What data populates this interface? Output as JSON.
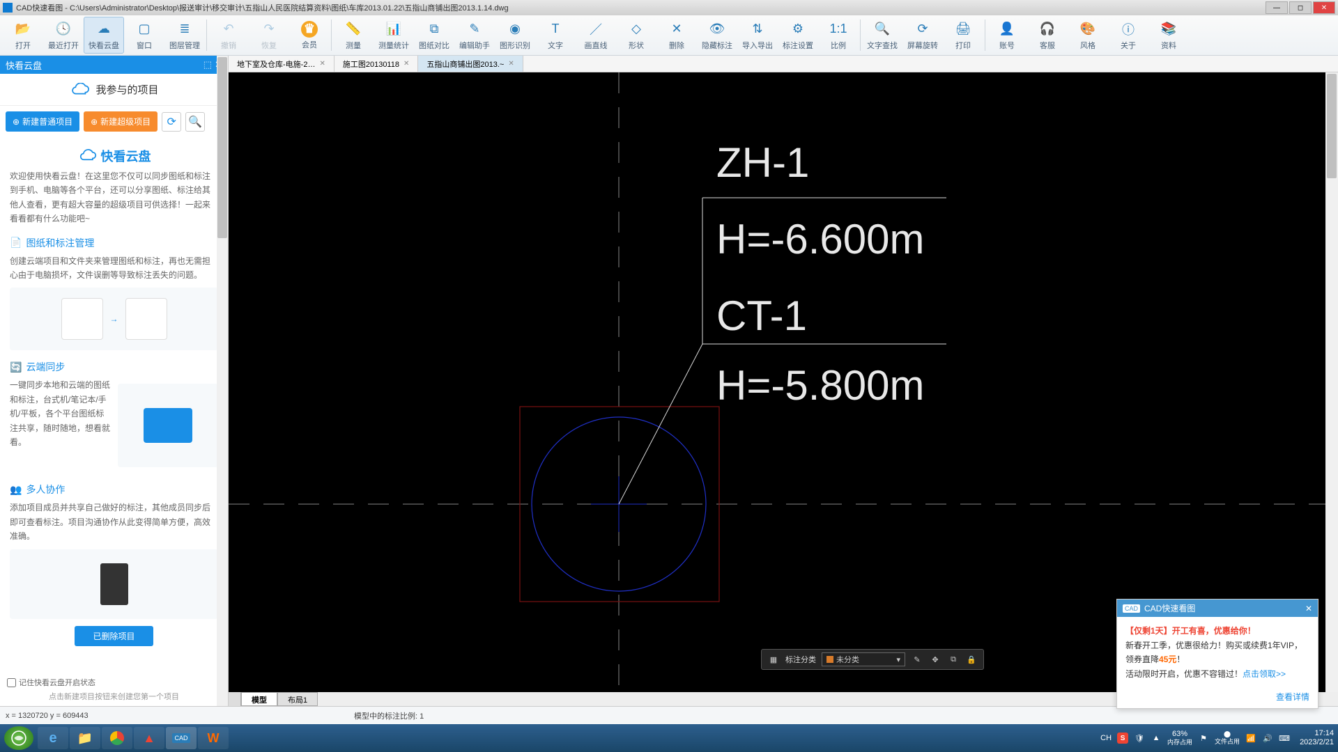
{
  "title": "CAD快速看图 - C:\\Users\\Administrator\\Desktop\\报送审计\\移交审计\\五指山人民医院结算资料\\图纸\\车库2013.01.22\\五指山商铺出图2013.1.14.dwg",
  "toolbar": [
    {
      "label": "打开"
    },
    {
      "label": "最近打开"
    },
    {
      "label": "快看云盘"
    },
    {
      "label": "窗口"
    },
    {
      "label": "图层管理"
    },
    {
      "label": "撤销"
    },
    {
      "label": "恢复"
    },
    {
      "label": "会员"
    },
    {
      "label": "测量"
    },
    {
      "label": "测量统计"
    },
    {
      "label": "图纸对比"
    },
    {
      "label": "编辑助手"
    },
    {
      "label": "图形识别"
    },
    {
      "label": "文字"
    },
    {
      "label": "画直线"
    },
    {
      "label": "形状"
    },
    {
      "label": "删除"
    },
    {
      "label": "隐藏标注"
    },
    {
      "label": "导入导出"
    },
    {
      "label": "标注设置"
    },
    {
      "label": "比例"
    },
    {
      "label": "文字查找"
    },
    {
      "label": "屏幕旋转"
    },
    {
      "label": "打印"
    },
    {
      "label": "账号"
    },
    {
      "label": "客服"
    },
    {
      "label": "风格"
    },
    {
      "label": "关于"
    },
    {
      "label": "资料"
    }
  ],
  "sidebar": {
    "header": "快看云盘",
    "sub": "我参与的项目",
    "btnNew": "新建普通项目",
    "btnSuper": "新建超级项目",
    "cardTitle": "快看云盘",
    "text1": "欢迎使用快看云盘！在这里您不仅可以同步图纸和标注到手机、电脑等各个平台，还可以分享图纸、标注给其他人查看，更有超大容量的超级项目可供选择！一起来看看都有什么功能吧~",
    "sub2": "图纸和标注管理",
    "text2": "创建云端项目和文件夹来管理图纸和标注，再也无需担心由于电脑损坏，文件误删等导致标注丢失的问题。",
    "sub3": "云端同步",
    "text3": "一键同步本地和云端的图纸和标注，台式机/笔记本/手机/平板，各个平台图纸标注共享，随时随地，想看就看。",
    "sub4": "多人协作",
    "text4": "添加项目成员并共享自己做好的标注，其他成员同步后即可查看标注。项目沟通协作从此变得简单方便，高效准确。",
    "deleted": "已删除项目",
    "chk": "记住快看云盘开启状态",
    "hint": "点击新建项目按钮来创建您第一个项目"
  },
  "tabs": [
    {
      "label": "地下室及仓库-电施-2…",
      "active": false
    },
    {
      "label": "施工图20130118",
      "active": false
    },
    {
      "label": "五指山商铺出图2013.~",
      "active": true
    }
  ],
  "drawing": {
    "label1": "ZH-1",
    "h1": "H=-6.600m",
    "label2": "CT-1",
    "h2": "H=-5.800m"
  },
  "cvsToolbar": {
    "cat": "标注分类",
    "val": "未分类"
  },
  "btmTabs": [
    "模型",
    "布局1"
  ],
  "status": {
    "coord": "x = 1320720  y = 609443",
    "scale": "模型中的标注比例: 1"
  },
  "popup": {
    "title": "CAD快速看图",
    "line1a": "【仅剩1天】",
    "line1b": "开工有喜，优惠给你！",
    "line2a": "新春开工季，优惠很给力！购买或续费1年VIP，领券直降",
    "line2b": "45元",
    "line2c": "！",
    "line3a": "活动限时开启，优惠不容错过！",
    "line3b": "点击领取>>",
    "more": "查看详情"
  },
  "tray": {
    "pct": "63%",
    "mem": "内存占用",
    "time": "17:14",
    "date": "2023/2/21",
    "lang": "CH",
    "fileFlag": "文件占用"
  }
}
